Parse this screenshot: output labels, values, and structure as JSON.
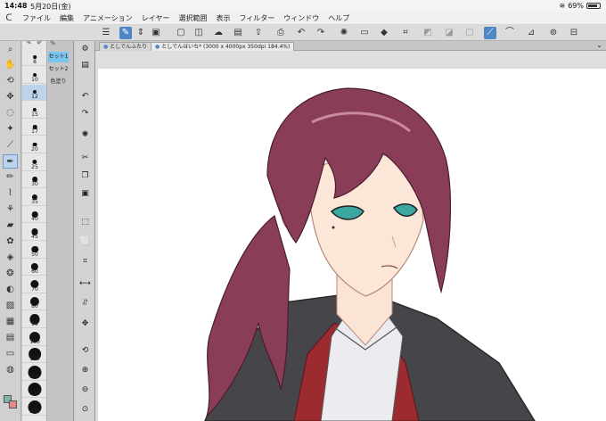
{
  "status": {
    "time": "14:48",
    "date": "5月20日(金)",
    "battery": "69%",
    "battery_level": 0.69
  },
  "menu": {
    "logo_icon": "clip-studio-logo-icon",
    "items": [
      "ファイル",
      "編集",
      "アニメーション",
      "レイヤー",
      "選択範囲",
      "表示",
      "フィルター",
      "ウィンドウ",
      "ヘルプ"
    ]
  },
  "toolbar_icons": [
    "menu-icon",
    "selection-tool-icon",
    "stepper-icon",
    "image-icon",
    "new-file-icon",
    "open-file-icon",
    "save-cloud-icon",
    "save-icon",
    "export-icon",
    "undo-icon",
    "redo-icon",
    "loading-icon",
    "erase-icon",
    "fill-icon",
    "transform-icon",
    "invert-icon",
    "selection-off-icon",
    "border-icon",
    "stabilizer-icon",
    "snap-icon",
    "ruler-icon",
    "perspective-icon",
    "settings-icon"
  ],
  "brush_sizes": [
    "8",
    "10",
    "12",
    "15",
    "17",
    "20",
    "25",
    "30",
    "35",
    "40",
    "45",
    "50",
    "60",
    "70",
    "80",
    "90",
    "100",
    "120",
    "150",
    "170",
    "200"
  ],
  "selected_brush_size": "12",
  "sets": {
    "set1": "セット1",
    "set2": "セット2",
    "color": "色塗り"
  },
  "tabs": {
    "tab1": "としでんふたり",
    "tab2": "としでんほいち* (3000 x 4000px 350dpi 184.4%)"
  },
  "colors": {
    "accent": "#4f86c6",
    "foreground": "#7fb5aa",
    "background": "#e9888c",
    "hair": "#8a3d56",
    "eye": "#3aa7a0",
    "jacket": "#46464a",
    "vest": "#9c2b2f"
  }
}
